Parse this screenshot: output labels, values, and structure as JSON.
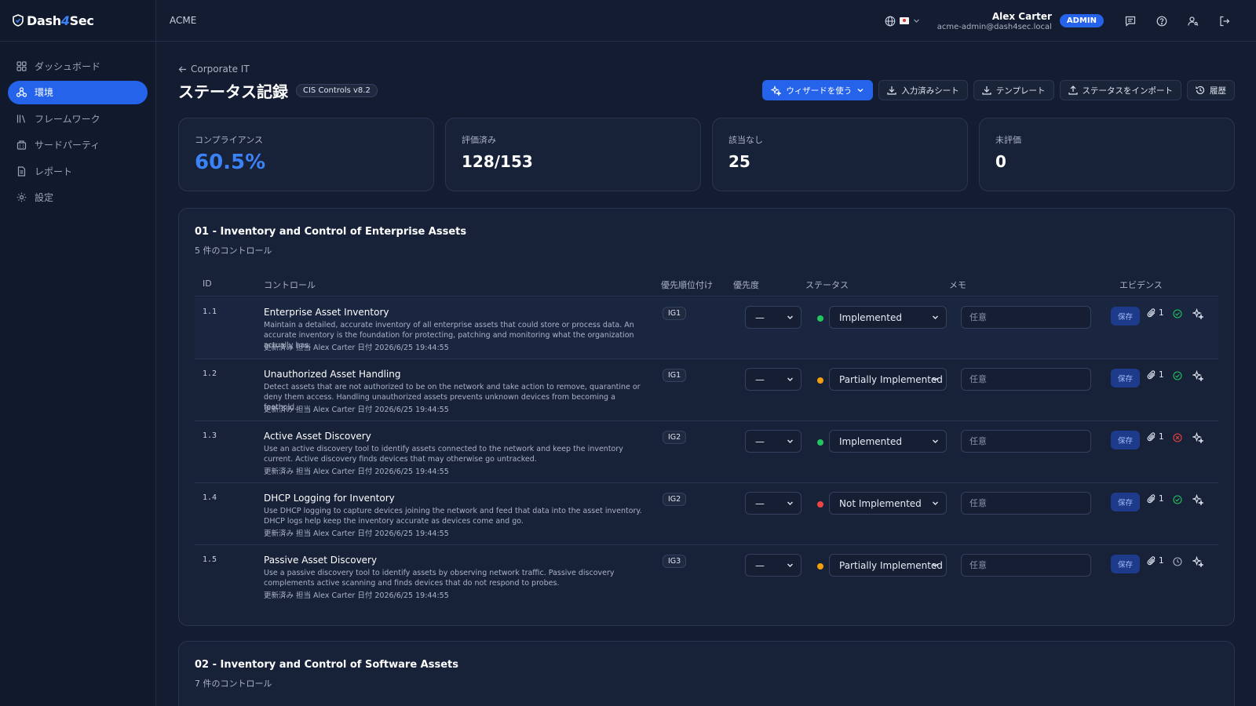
{
  "app": {
    "logo_text_a": "Dash",
    "logo_text_b": "4",
    "logo_text_c": "Sec",
    "tenant": "ACME"
  },
  "sidebar": {
    "items": [
      {
        "label": "ダッシュボード",
        "icon": "grid-icon"
      },
      {
        "label": "環境",
        "icon": "network-icon"
      },
      {
        "label": "フレームワーク",
        "icon": "library-icon"
      },
      {
        "label": "サードパーティ",
        "icon": "building-icon"
      },
      {
        "label": "レポート",
        "icon": "document-icon"
      },
      {
        "label": "設定",
        "icon": "gear-icon"
      }
    ],
    "active_index": 1
  },
  "header": {
    "user_name": "Alex Carter",
    "user_email": "acme-admin@dash4sec.local",
    "role": "ADMIN"
  },
  "page": {
    "breadcrumb": "Corporate IT",
    "title": "ステータス記録",
    "framework_badge": "CIS Controls v8.2",
    "actions": {
      "wizard": "ウィザードを使う",
      "filled_sheet": "入力済みシート",
      "template": "テンプレート",
      "import_status": "ステータスをインポート",
      "history": "履歴"
    }
  },
  "stats": [
    {
      "label": "コンプライアンス",
      "value": "60.5%"
    },
    {
      "label": "評価済み",
      "value": "128/153"
    },
    {
      "label": "該当なし",
      "value": "25"
    },
    {
      "label": "未評価",
      "value": "0"
    }
  ],
  "table_headers": {
    "id": "ID",
    "control": "コントロール",
    "prioritization": "優先順位付け",
    "priority": "優先度",
    "status": "ステータス",
    "memo": "メモ",
    "evidence": "エビデンス"
  },
  "sections": [
    {
      "title": "01 - Inventory and Control of Enterprise Assets",
      "subtitle": "5 件のコントロール",
      "rows": [
        {
          "id": "1.1",
          "title": "Enterprise Asset Inventory",
          "desc": "Maintain a detailed, accurate inventory of all enterprise assets that could store or process data. An accurate inventory is the foundation for protecting, patching and monitoring what the organization actually has.",
          "meta": "更新済み 担当 Alex Carter 日付 2026/6/25 19:44:55",
          "ig": "IG1",
          "priority": "—",
          "status": "Implemented",
          "status_color": "#22c55e",
          "memo_placeholder": "任意",
          "save": "保存",
          "attachments": "1",
          "evidence_state": "verified-icon"
        },
        {
          "id": "1.2",
          "title": "Unauthorized Asset Handling",
          "desc": "Detect assets that are not authorized to be on the network and take action to remove, quarantine or deny them access. Handling unauthorized assets prevents unknown devices from becoming a foothold.",
          "meta": "更新済み 担当 Alex Carter 日付 2026/6/25 19:44:55",
          "ig": "IG1",
          "priority": "—",
          "status": "Partially Implemented",
          "status_color": "#f59e0b",
          "memo_placeholder": "任意",
          "save": "保存",
          "attachments": "1",
          "evidence_state": "verified-icon"
        },
        {
          "id": "1.3",
          "title": "Active Asset Discovery",
          "desc": "Use an active discovery tool to identify assets connected to the network and keep the inventory current. Active discovery finds devices that may otherwise go untracked.",
          "meta": "更新済み 担当 Alex Carter 日付 2026/6/25 19:44:55",
          "ig": "IG2",
          "priority": "—",
          "status": "Implemented",
          "status_color": "#22c55e",
          "memo_placeholder": "任意",
          "save": "保存",
          "attachments": "1",
          "evidence_state": "rejected-icon"
        },
        {
          "id": "1.4",
          "title": "DHCP Logging for Inventory",
          "desc": "Use DHCP logging to capture devices joining the network and feed that data into the asset inventory. DHCP logs help keep the inventory accurate as devices come and go.",
          "meta": "更新済み 担当 Alex Carter 日付 2026/6/25 19:44:55",
          "ig": "IG2",
          "priority": "—",
          "status": "Not Implemented",
          "status_color": "#ef4444",
          "memo_placeholder": "任意",
          "save": "保存",
          "attachments": "1",
          "evidence_state": "verified-icon"
        },
        {
          "id": "1.5",
          "title": "Passive Asset Discovery",
          "desc": "Use a passive discovery tool to identify assets by observing network traffic. Passive discovery complements active scanning and finds devices that do not respond to probes.",
          "meta": "更新済み 担当 Alex Carter 日付 2026/6/25 19:44:55",
          "ig": "IG3",
          "priority": "—",
          "status": "Partially Implemented",
          "status_color": "#f59e0b",
          "memo_placeholder": "任意",
          "save": "保存",
          "attachments": "1",
          "evidence_state": "pending-icon"
        }
      ]
    },
    {
      "title": "02 - Inventory and Control of Software Assets",
      "subtitle": "7 件のコントロール"
    }
  ]
}
